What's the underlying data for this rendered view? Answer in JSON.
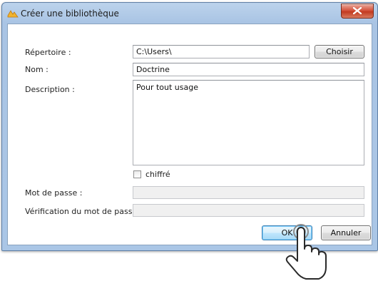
{
  "dialog": {
    "title": "Créer une bibliothèque",
    "close_icon": "close-icon",
    "app_icon": "library-app-icon"
  },
  "form": {
    "repertoire_label": "Répertoire :",
    "repertoire_value": "C:\\Users\\",
    "choisir_label": "Choisir",
    "nom_label": "Nom :",
    "nom_value": "Doctrine",
    "description_label": "Description :",
    "description_value": "Pour tout usage",
    "chiffre_label": "chiffré",
    "chiffre_checked": false,
    "mot_de_passe_label": "Mot de passe :",
    "mot_de_passe_value": "",
    "verification_label": "Vérification du mot de passe :",
    "verification_value": ""
  },
  "buttons": {
    "ok_label": "OK",
    "annuler_label": "Annuler"
  },
  "pointer": {
    "icon": "hand-pointer-icon"
  }
}
